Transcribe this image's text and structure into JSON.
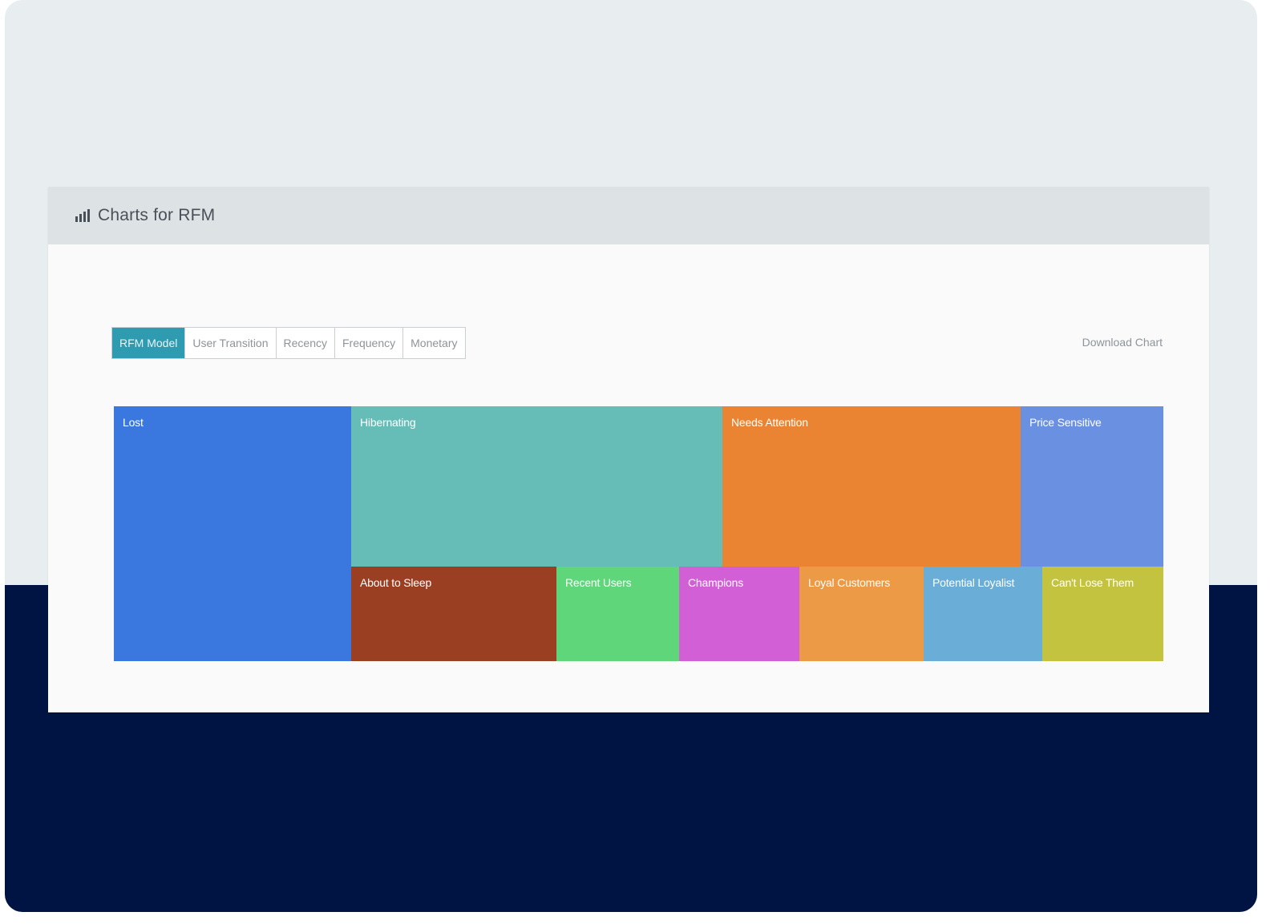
{
  "panel": {
    "title": "Charts for RFM",
    "icon": "bar-chart-icon"
  },
  "tabs": [
    {
      "label": "RFM Model",
      "active": true
    },
    {
      "label": "User Transition",
      "active": false
    },
    {
      "label": "Recency",
      "active": false
    },
    {
      "label": "Frequency",
      "active": false
    },
    {
      "label": "Monetary",
      "active": false
    }
  ],
  "download_label": "Download Chart",
  "chart_data": {
    "type": "treemap",
    "segments": [
      {
        "name": "Lost",
        "color": "#3a78e0"
      },
      {
        "name": "Hibernating",
        "color": "#66bdb8"
      },
      {
        "name": "Needs Attention",
        "color": "#ea8433"
      },
      {
        "name": "Price Sensitive",
        "color": "#6a90e2"
      },
      {
        "name": "About to Sleep",
        "color": "#9b3f23"
      },
      {
        "name": "Recent Users",
        "color": "#5fd67a"
      },
      {
        "name": "Champions",
        "color": "#d35fd6"
      },
      {
        "name": "Loyal Customers",
        "color": "#ec9a45"
      },
      {
        "name": "Potential Loyalist",
        "color": "#6aaed8"
      },
      {
        "name": "Can't Lose Them",
        "color": "#c4c340"
      }
    ]
  }
}
